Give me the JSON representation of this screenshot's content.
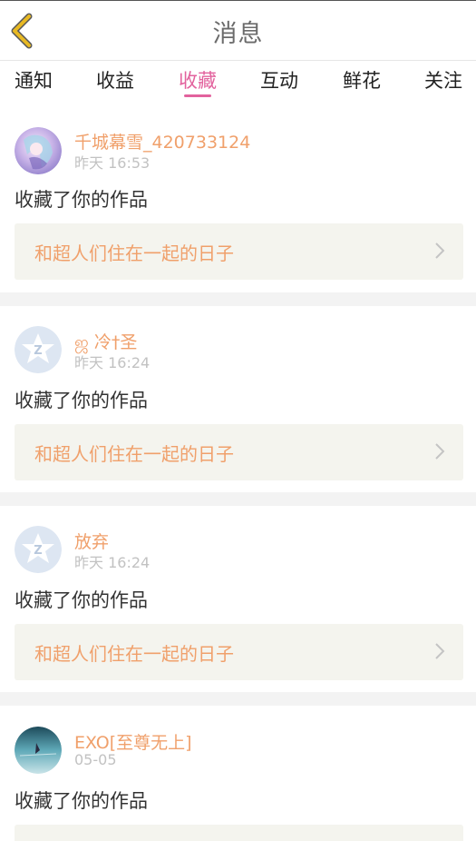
{
  "header": {
    "title": "消息",
    "back_icon": "chevron-left-icon",
    "back_color": "#e8b923"
  },
  "tabs": [
    {
      "label": "通知",
      "active": false
    },
    {
      "label": "收益",
      "active": false
    },
    {
      "label": "收藏",
      "active": true
    },
    {
      "label": "互动",
      "active": false
    },
    {
      "label": "鲜花",
      "active": false
    },
    {
      "label": "关注",
      "active": false
    }
  ],
  "colors": {
    "accent": "#e2629d",
    "username": "#f0a06b",
    "work_title": "#f0a06b",
    "time": "#c2c2c2"
  },
  "notifications": [
    {
      "username": "千城幕雪_420733124",
      "time": "昨天 16:53",
      "action": "收藏了你的作品",
      "work_title": "和超人们住在一起的日子",
      "avatar": "anime-avatar"
    },
    {
      "username": "ஜ 冷†圣",
      "time": "昨天 16:24",
      "action": "收藏了你的作品",
      "work_title": "和超人们住在一起的日子",
      "avatar": "default-avatar"
    },
    {
      "username": "放弃",
      "time": "昨天 16:24",
      "action": "收藏了你的作品",
      "work_title": "和超人们住在一起的日子",
      "avatar": "default-avatar"
    },
    {
      "username": "EXO[至尊无上]",
      "time": "05-05",
      "action": "收藏了你的作品",
      "work_title": "",
      "avatar": "photo-avatar"
    }
  ]
}
